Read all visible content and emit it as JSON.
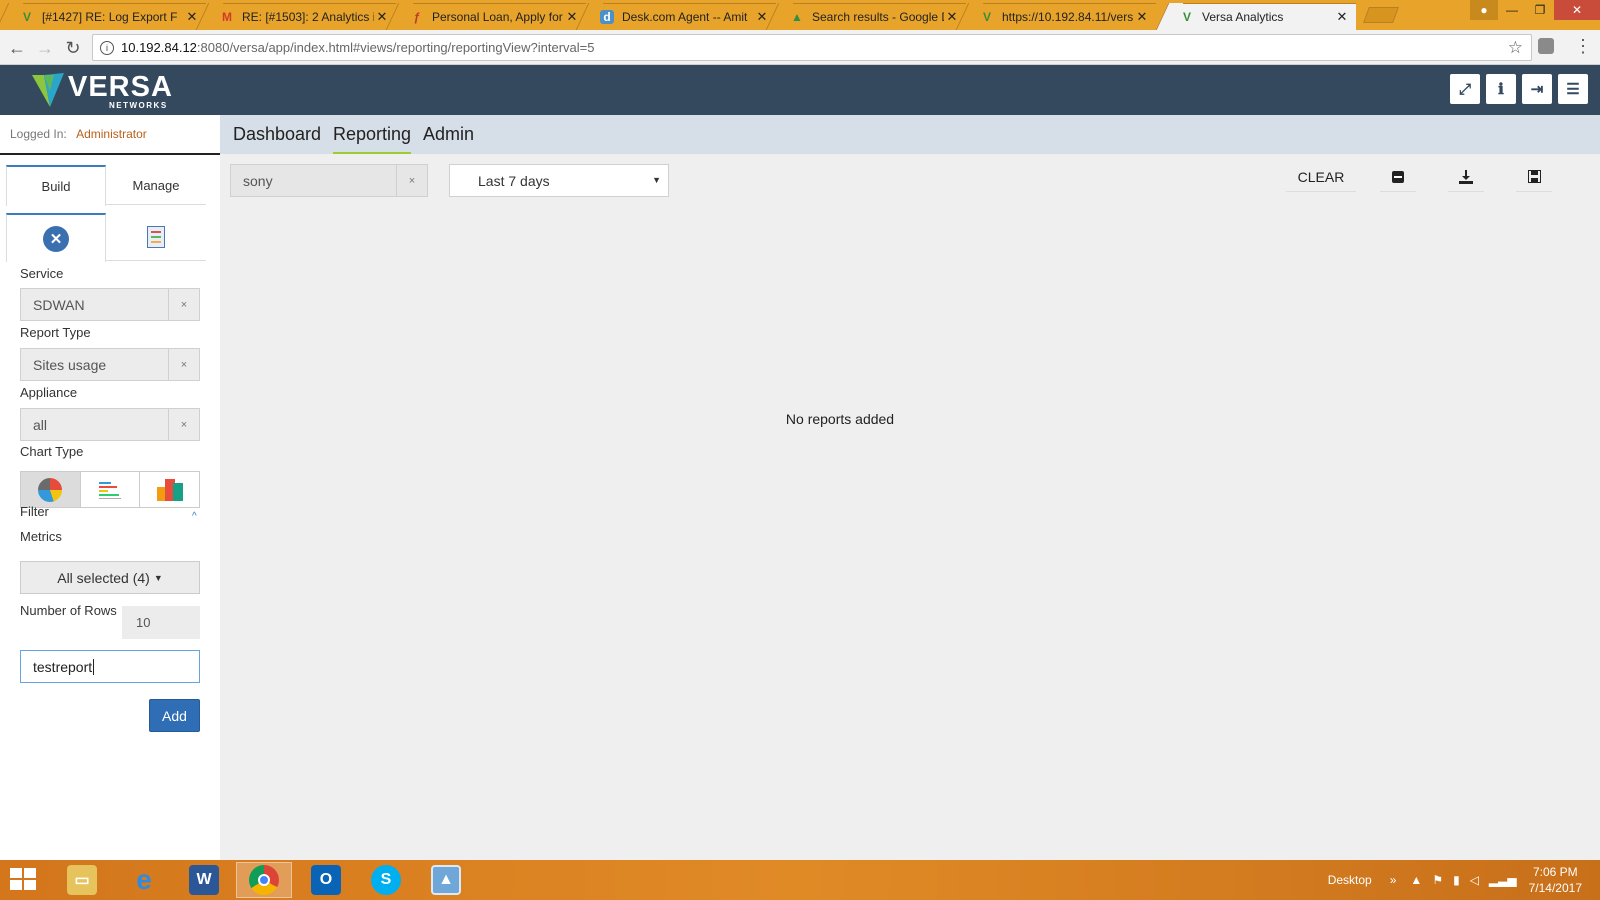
{
  "browser": {
    "tabs": [
      {
        "title": "[#1427] RE: Log Export F",
        "icon": "versa-favicon"
      },
      {
        "title": "RE: [#1503]: 2 Analytics i",
        "icon": "gmail-favicon"
      },
      {
        "title": "Personal Loan, Apply for",
        "icon": "loan-favicon"
      },
      {
        "title": "Desk.com Agent -- Amit",
        "icon": "desk-favicon"
      },
      {
        "title": "Search results - Google D",
        "icon": "drive-favicon"
      },
      {
        "title": "https://10.192.84.11/vers",
        "icon": "versa-favicon"
      },
      {
        "title": "Versa Analytics",
        "icon": "versa-favicon"
      }
    ],
    "url_host": "10.192.84.12",
    "url_path": ":8080/versa/app/index.html#views/reporting/reportingView?interval=5"
  },
  "header": {
    "brand": "VERSA",
    "brand_sub": "NETWORKS"
  },
  "sidebar": {
    "logged_in_label": "Logged In:",
    "logged_in_user": "Administrator",
    "tabs": [
      "Build",
      "Manage"
    ],
    "service_label": "Service",
    "service_value": "SDWAN",
    "report_type_label": "Report Type",
    "report_type_value": "Sites usage",
    "appliance_label": "Appliance",
    "appliance_value": "all",
    "chart_type_label": "Chart Type",
    "filter_label": "Filter",
    "metrics_label": "Metrics",
    "metrics_value": "All selected (4)",
    "rows_label": "Number of Rows",
    "rows_value": "10",
    "report_name_value": "testreport",
    "add_label": "Add",
    "clear_symbol": "×"
  },
  "nav": {
    "items": [
      "Dashboard",
      "Reporting",
      "Admin"
    ]
  },
  "main": {
    "org_filter_value": "sony",
    "range_value": "Last 7 days",
    "clear_label": "CLEAR",
    "empty_message": "No reports added"
  },
  "taskbar": {
    "desktop_label": "Desktop",
    "time": "7:06 PM",
    "date": "7/14/2017"
  }
}
